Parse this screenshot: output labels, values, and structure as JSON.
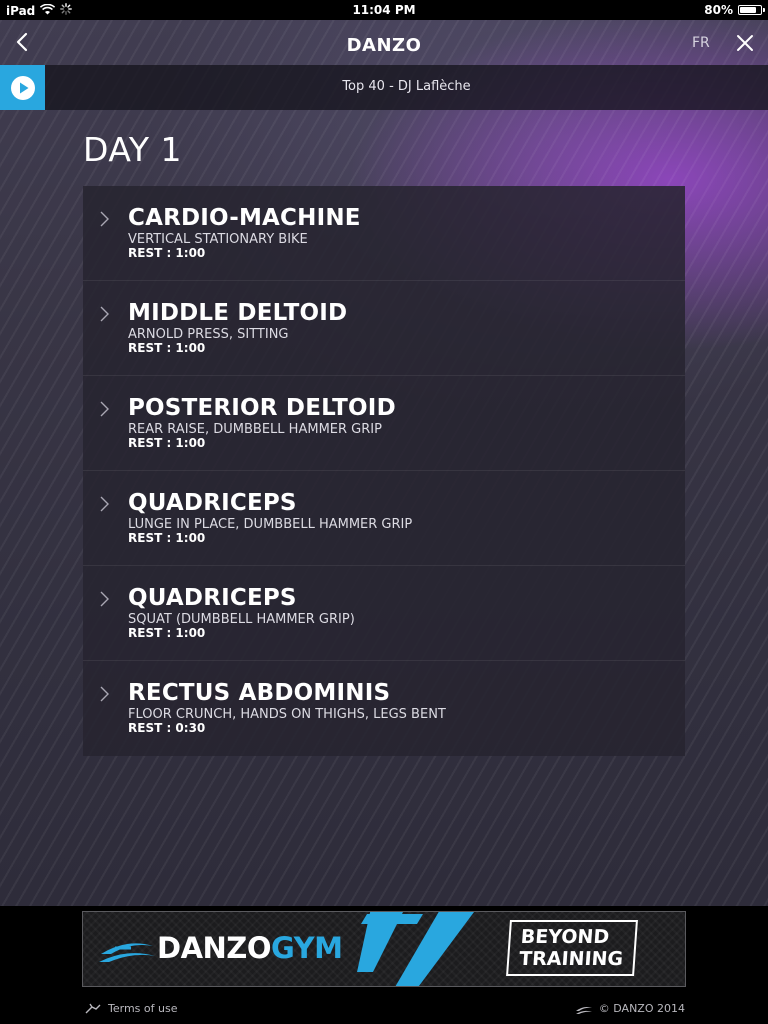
{
  "status_bar": {
    "device": "iPad",
    "time": "11:04 PM",
    "battery": "80%",
    "battery_level": 0.8
  },
  "nav": {
    "title": "DANZO",
    "language": "FR",
    "back_icon": "chevron-left-icon",
    "close_icon": "close-icon"
  },
  "player": {
    "track": "Top 40 - DJ Laflèche",
    "play_icon": "play-icon",
    "accent": "#29a7df"
  },
  "day": {
    "title": "DAY 1"
  },
  "exercises": [
    {
      "title": "CARDIO-MACHINE",
      "subtitle": "VERTICAL STATIONARY BIKE",
      "rest": "REST : 1:00"
    },
    {
      "title": "MIDDLE DELTOID",
      "subtitle": "ARNOLD PRESS, SITTING",
      "rest": "REST : 1:00"
    },
    {
      "title": "POSTERIOR DELTOID",
      "subtitle": "REAR RAISE, DUMBBELL HAMMER GRIP",
      "rest": "REST : 1:00"
    },
    {
      "title": "QUADRICEPS",
      "subtitle": "LUNGE IN PLACE, DUMBBELL HAMMER GRIP",
      "rest": "REST : 1:00"
    },
    {
      "title": "QUADRICEPS",
      "subtitle": "SQUAT (DUMBBELL HAMMER GRIP)",
      "rest": "REST : 1:00"
    },
    {
      "title": "RECTUS ABDOMINIS",
      "subtitle": "FLOOR CRUNCH, HANDS ON THIGHS, LEGS BENT",
      "rest": "REST : 0:30"
    }
  ],
  "banner": {
    "brand_white": "DANZO",
    "brand_blue": "GYM",
    "tagline_line1": "BEYOND",
    "tagline_line2": "TRAINING",
    "brand_color": "#29a7df"
  },
  "footer": {
    "terms": "Terms of use",
    "copyright": "© DANZO 2014"
  }
}
